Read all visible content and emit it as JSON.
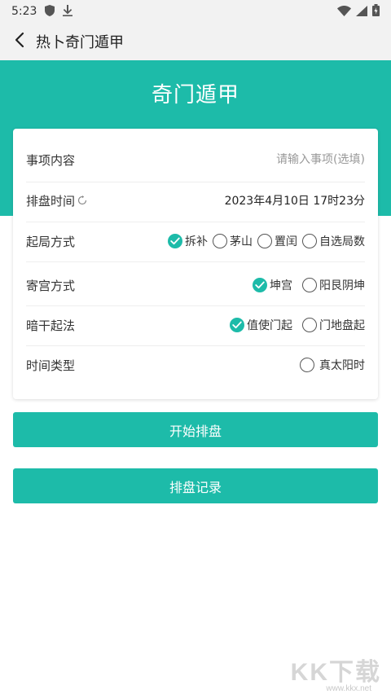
{
  "status_bar": {
    "time": "5:23",
    "left_icons": [
      "shield-icon",
      "download-icon"
    ],
    "right_icons": [
      "wifi-icon",
      "signal-icon",
      "battery-icon"
    ]
  },
  "app_bar": {
    "title": "热卜奇门遁甲",
    "back_icon": "chevron-left-icon"
  },
  "header": {
    "title": "奇门遁甲"
  },
  "form": {
    "matter": {
      "label": "事项内容",
      "value": "",
      "placeholder": "请输入事项(选填)"
    },
    "time": {
      "label": "排盘时间",
      "value": "2023年4月10日 17时23分",
      "icon": "refresh-icon"
    },
    "start_method": {
      "label": "起局方式",
      "options": [
        {
          "label": "拆补",
          "checked": true
        },
        {
          "label": "茅山",
          "checked": false
        },
        {
          "label": "置闰",
          "checked": false
        },
        {
          "label": "自选局数",
          "checked": false
        }
      ]
    },
    "palace_method": {
      "label": "寄宫方式",
      "options": [
        {
          "label": "坤宫",
          "checked": true
        },
        {
          "label": "阳艮阴坤",
          "checked": false
        }
      ]
    },
    "hidden_stem": {
      "label": "暗干起法",
      "options": [
        {
          "label": "值使门起",
          "checked": true
        },
        {
          "label": "门地盘起",
          "checked": false
        }
      ]
    },
    "time_type": {
      "label": "时间类型",
      "options": [
        {
          "label": "真太阳时",
          "checked": false
        }
      ]
    }
  },
  "buttons": {
    "start": "开始排盘",
    "records": "排盘记录"
  },
  "colors": {
    "accent": "#1dbba9",
    "background": "#ffffff",
    "bar": "#f2f2f2"
  },
  "watermark": {
    "text": "KK下载",
    "url": "www.kkx.net"
  }
}
